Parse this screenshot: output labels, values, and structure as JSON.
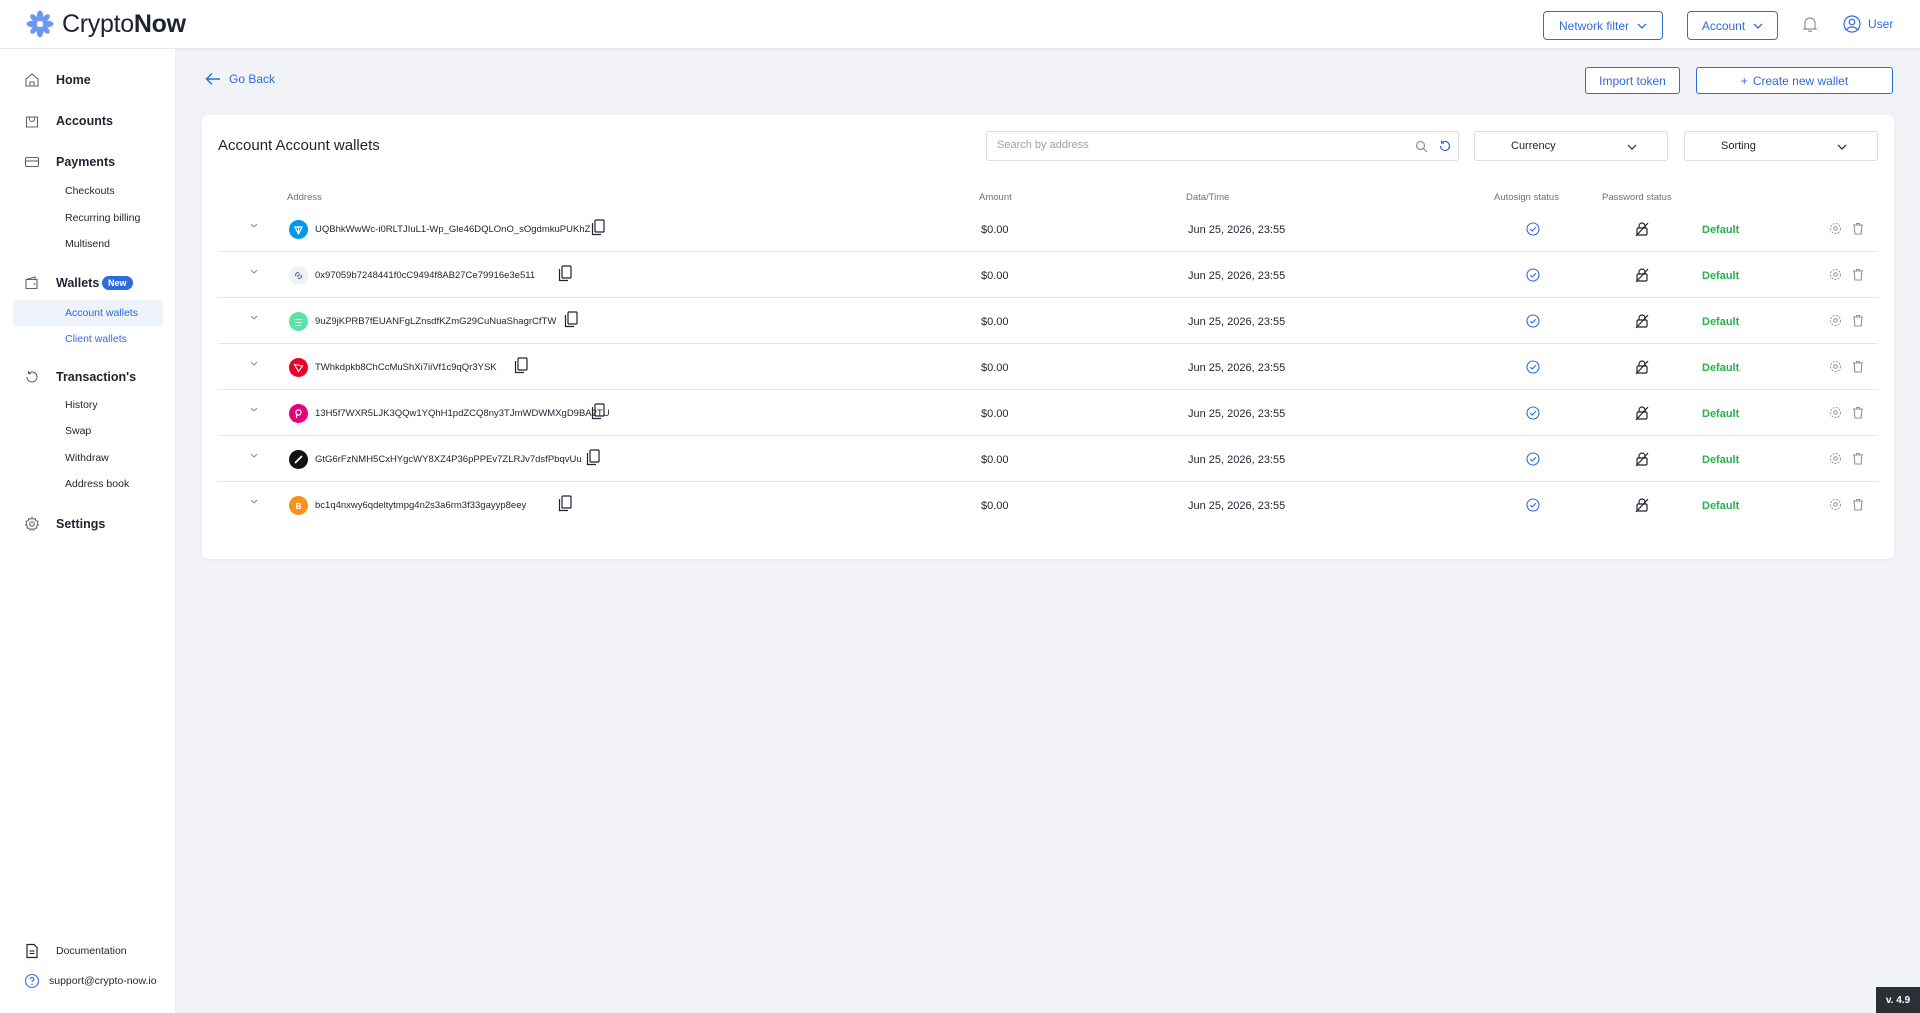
{
  "brand": {
    "name_light": "Crypto",
    "name_bold": "Now"
  },
  "header": {
    "network_filter": "Network filter",
    "account": "Account",
    "user": "User"
  },
  "sidebar": {
    "home": "Home",
    "accounts": "Accounts",
    "payments": "Payments",
    "payments_items": [
      "Checkouts",
      "Recurring billing",
      "Multisend"
    ],
    "wallets": "Wallets",
    "wallets_badge": "New",
    "wallets_items": [
      "Account wallets",
      "Client wallets"
    ],
    "transactions": "Transaction's",
    "transactions_items": [
      "History",
      "Swap",
      "Withdraw",
      "Address book"
    ],
    "settings": "Settings",
    "documentation": "Documentation",
    "support": "support@crypto-now.io"
  },
  "toolbar": {
    "go_back": "Go Back",
    "import_token": "Import token",
    "create_wallet": "Create new wallet"
  },
  "card": {
    "title": "Account Account wallets",
    "search_placeholder": "Search by address",
    "currency": "Currency",
    "sorting": "Sorting"
  },
  "table": {
    "headers": {
      "address": "Address",
      "amount": "Amount",
      "datetime": "Data/Time",
      "autosign": "Autosign status",
      "password": "Password status"
    },
    "rows": [
      {
        "coin_icon": "ton-icon",
        "coin_color": "#0098ea",
        "address": "UQBhkWwWc-i0RLTJIuL1-Wp_Gle46DQLOnO_sOgdmkuPUKhZ",
        "amount": "$0.00",
        "datetime": "Jun 25, 2026, 23:55",
        "status": "Default"
      },
      {
        "coin_icon": "chainlink-icon",
        "coin_color": "#eef1f6",
        "address": "0x97059b7248441f0cC9494f8AB27Ce79916e3e511",
        "amount": "$0.00",
        "datetime": "Jun 25, 2026, 23:55",
        "status": "Default"
      },
      {
        "coin_icon": "solana-icon",
        "coin_color": "#5be3a6",
        "address": "9uZ9jKPRB7fEUANFgLZnsdfKZmG29CuNuaShagrCfTW",
        "amount": "$0.00",
        "datetime": "Jun 25, 2026, 23:55",
        "status": "Default"
      },
      {
        "coin_icon": "tron-icon",
        "coin_color": "#eb0029",
        "address": "TWhkdpkb8ChCcMuShXi7iiVf1c9qQr3YSK",
        "amount": "$0.00",
        "datetime": "Jun 25, 2026, 23:55",
        "status": "Default"
      },
      {
        "coin_icon": "polkadot-icon",
        "coin_color": "#e6007a",
        "address": "13H5f7WXR5LJK3QQw1YQhH1pdZCQ8ny3TJmWDWMXgD9BA2TU",
        "amount": "$0.00",
        "datetime": "Jun 25, 2026, 23:55",
        "status": "Default"
      },
      {
        "coin_icon": "near-icon",
        "coin_color": "#111111",
        "address": "GtG6rFzNMH5CxHYgcWY8XZ4P36pPPEv7ZLRJv7dsfPbqvUu",
        "amount": "$0.00",
        "datetime": "Jun 25, 2026, 23:55",
        "status": "Default"
      },
      {
        "coin_icon": "bitcoin-icon",
        "coin_color": "#f7931a",
        "address": "bc1q4nxwy6qdeltytmpg4n2s3a6rm3f33gayyp8eey",
        "amount": "$0.00",
        "datetime": "Jun 25, 2026, 23:55",
        "status": "Default"
      }
    ]
  },
  "version": "v. 4.9"
}
